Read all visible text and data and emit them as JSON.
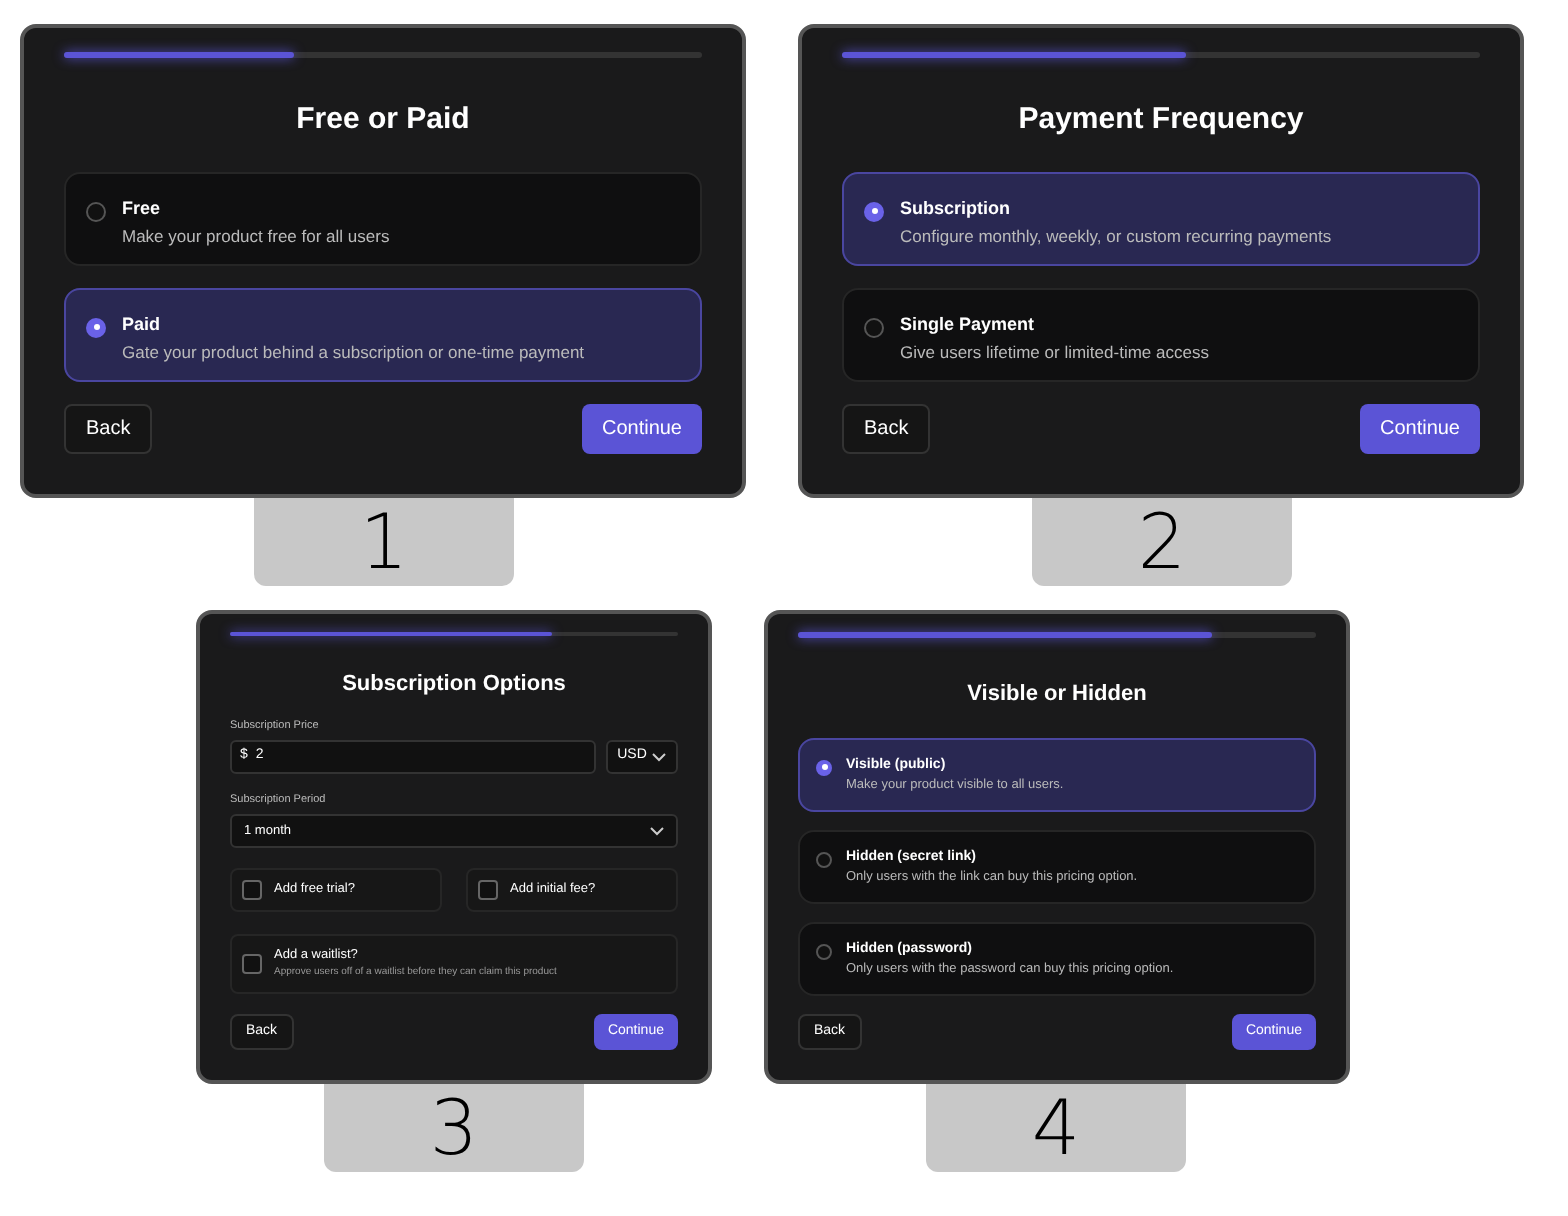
{
  "panels": [
    {
      "kind": "choice",
      "step": "1",
      "level": 0.36,
      "title": "Free or Paid",
      "options": [
        {
          "label": "Free",
          "description": "Make your product free for all users",
          "selected": false
        },
        {
          "label": "Paid",
          "description": "Gate your product behind a subscription or one-time payment",
          "selected": true
        }
      ],
      "back": "Back",
      "continue": "Continue"
    },
    {
      "kind": "choice",
      "step": "2",
      "level": 0.54,
      "title": "Payment Frequency",
      "options": [
        {
          "label": "Subscription",
          "description": "Configure monthly, weekly, or custom recurring payments",
          "selected": true
        },
        {
          "label": "Single Payment",
          "description": "Give users lifetime or limited-time access",
          "selected": false
        }
      ],
      "back": "Back",
      "continue": "Continue"
    },
    {
      "kind": "form",
      "step": "3",
      "level": 0.72,
      "title": "Subscription Options",
      "price": {
        "label": "Subscription Price",
        "prefix": "$",
        "value": "2",
        "currency": "USD"
      },
      "period": {
        "label": "Subscription Period",
        "value": "1 month"
      },
      "checkboxes": [
        {
          "label": "Add free trial?",
          "checked": false
        },
        {
          "label": "Add initial fee?",
          "checked": false
        }
      ],
      "waitlist": {
        "label": "Add a waitlist?",
        "description": "Approve users off of a waitlist before they can claim this product",
        "checked": false
      },
      "back": "Back",
      "continue": "Continue"
    },
    {
      "kind": "choice",
      "step": "4",
      "level": 0.8,
      "title": "Visible or Hidden",
      "options": [
        {
          "label": "Visible (public)",
          "description": "Make your product visible to all users.",
          "selected": true
        },
        {
          "label": "Hidden (secret link)",
          "description": "Only users with the link can buy this pricing option.",
          "selected": false
        },
        {
          "label": "Hidden (password)",
          "description": "Only users with the password can buy this pricing option.",
          "selected": false
        }
      ],
      "back": "Back",
      "continue": "Continue"
    }
  ]
}
